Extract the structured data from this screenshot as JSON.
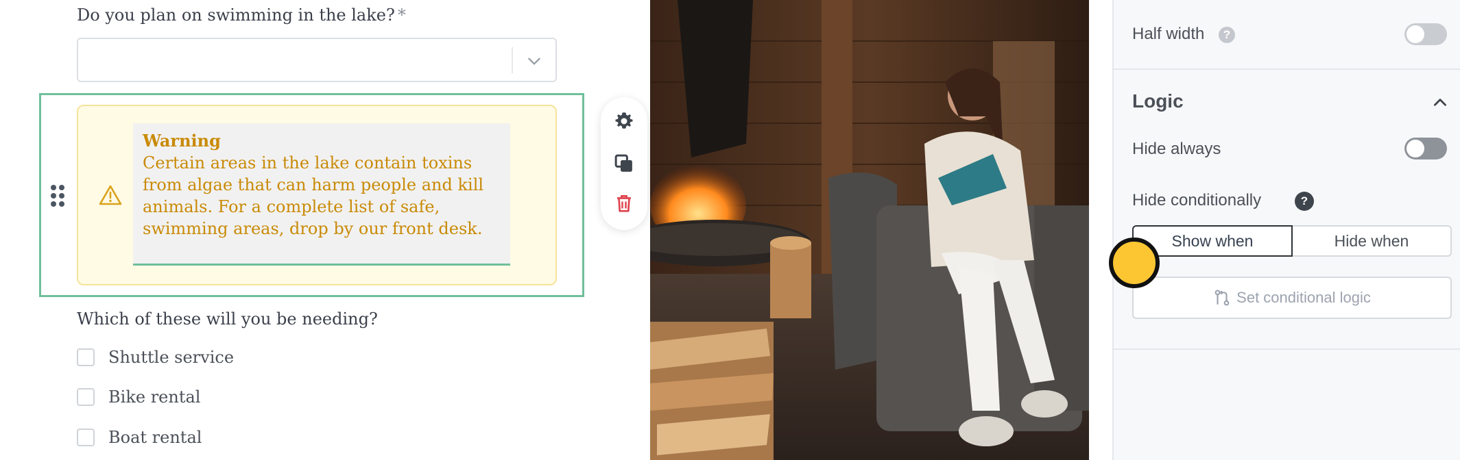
{
  "form": {
    "question1": {
      "label": "Do you plan on swimming in the lake?",
      "required_marker": "*",
      "select_value": ""
    },
    "alert": {
      "title": "Warning",
      "text": "Certain areas in the lake contain toxins from algae that can harm people and kill animals. For a complete list of safe, swimming areas, drop by our front desk."
    },
    "question2": {
      "label": "Which of these will you be needing?",
      "options": [
        {
          "label": "Shuttle service",
          "checked": false
        },
        {
          "label": "Bike rental",
          "checked": false
        },
        {
          "label": "Boat rental",
          "checked": false
        }
      ]
    }
  },
  "block_toolbar": {
    "icons": [
      "gear-icon",
      "duplicate-icon",
      "trash-icon"
    ],
    "delete_color": "#e0454f"
  },
  "panel": {
    "half_width": {
      "label": "Half width",
      "enabled": false
    },
    "logic": {
      "title": "Logic",
      "hide_always": {
        "label": "Hide always",
        "enabled": false
      },
      "hide_conditionally": {
        "label": "Hide conditionally"
      },
      "segments": [
        "Show when",
        "Hide when"
      ],
      "active_segment": "Show when",
      "set_logic_label": "Set conditional logic"
    }
  },
  "colors": {
    "accent_green": "#6fbf9a",
    "warning_text": "#c98a06",
    "warning_bg": "#fffbe5",
    "cursor": "#fcc633"
  }
}
